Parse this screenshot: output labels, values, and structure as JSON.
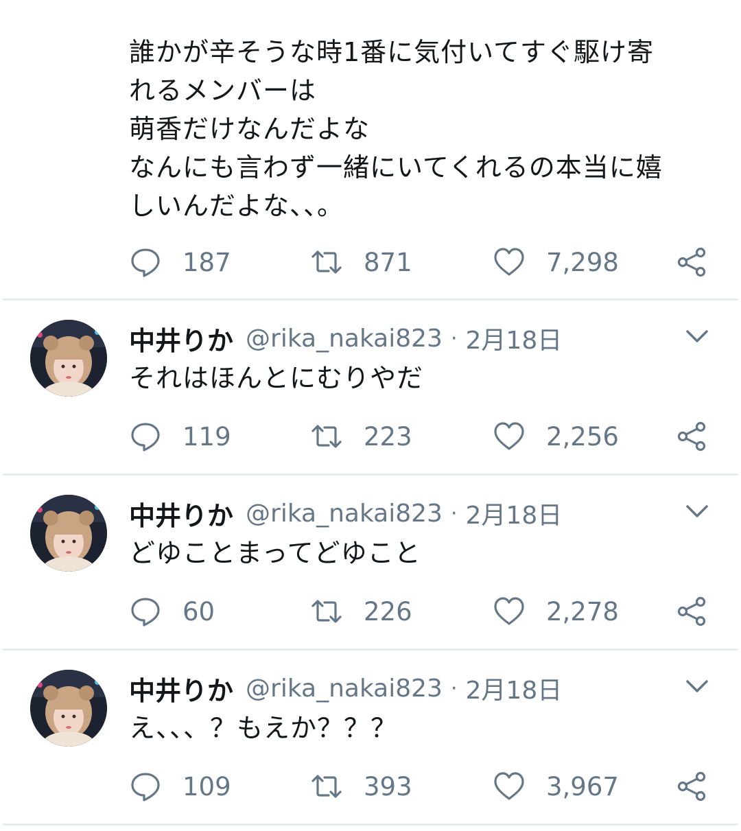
{
  "first_tweet": {
    "text": "誰かが辛そうな時1番に気付いてすぐ駆け寄\nれるメンバーは\n萌香だけなんだよな\nなんにも言わず一緒にいてくれるの本当に嬉\nしいんだよな、、。",
    "replies": "187",
    "retweets": "871",
    "likes": "7,298"
  },
  "replies": [
    {
      "name": "中井りか",
      "handle": "@rika_nakai823",
      "separator": "·",
      "date": "2月18日",
      "text": "それはほんとにむりやだ",
      "replies": "119",
      "retweets": "223",
      "likes": "2,256"
    },
    {
      "name": "中井りか",
      "handle": "@rika_nakai823",
      "separator": "·",
      "date": "2月18日",
      "text": "どゆことまってどゆこと",
      "replies": "60",
      "retweets": "226",
      "likes": "2,278"
    },
    {
      "name": "中井りか",
      "handle": "@rika_nakai823",
      "separator": "·",
      "date": "2月18日",
      "text": "え、、、？もえか？？？",
      "replies": "109",
      "retweets": "393",
      "likes": "3,967"
    }
  ],
  "icons": {
    "reply": "reply-icon",
    "retweet": "retweet-icon",
    "like": "heart-icon",
    "share": "share-icon",
    "menu": "chevron-down-icon"
  },
  "colors": {
    "text": "#14171a",
    "secondary": "#657786",
    "divider": "#e6ecf0"
  }
}
